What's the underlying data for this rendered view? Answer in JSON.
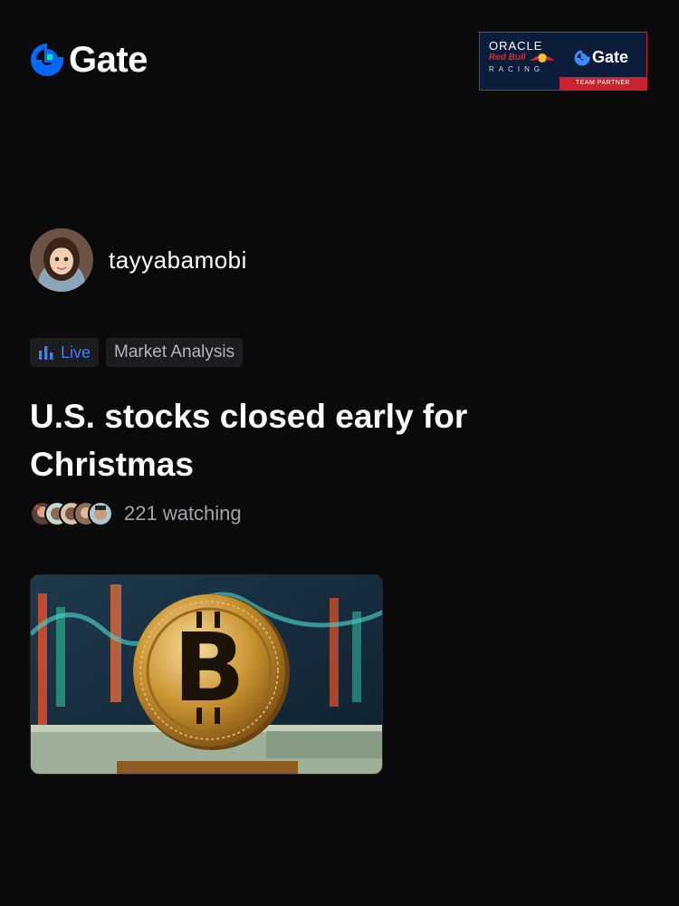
{
  "brand": {
    "name": "Gate"
  },
  "partner": {
    "oracle": "ORACLE",
    "redbull": "Red Bull",
    "racing": "RACING",
    "gate": "Gate",
    "ribbon": "TEAM PARTNER"
  },
  "author": {
    "name": "tayyabamobi"
  },
  "tags": {
    "live": "Live",
    "category": "Market Analysis"
  },
  "post": {
    "title": "U.S. stocks closed early for Christmas"
  },
  "watching": {
    "text": "221 watching"
  },
  "colors": {
    "background": "#0a0a0b",
    "brand_blue": "#0068ff",
    "live_blue": "#3d7eff",
    "partner_red": "#c9232f"
  }
}
